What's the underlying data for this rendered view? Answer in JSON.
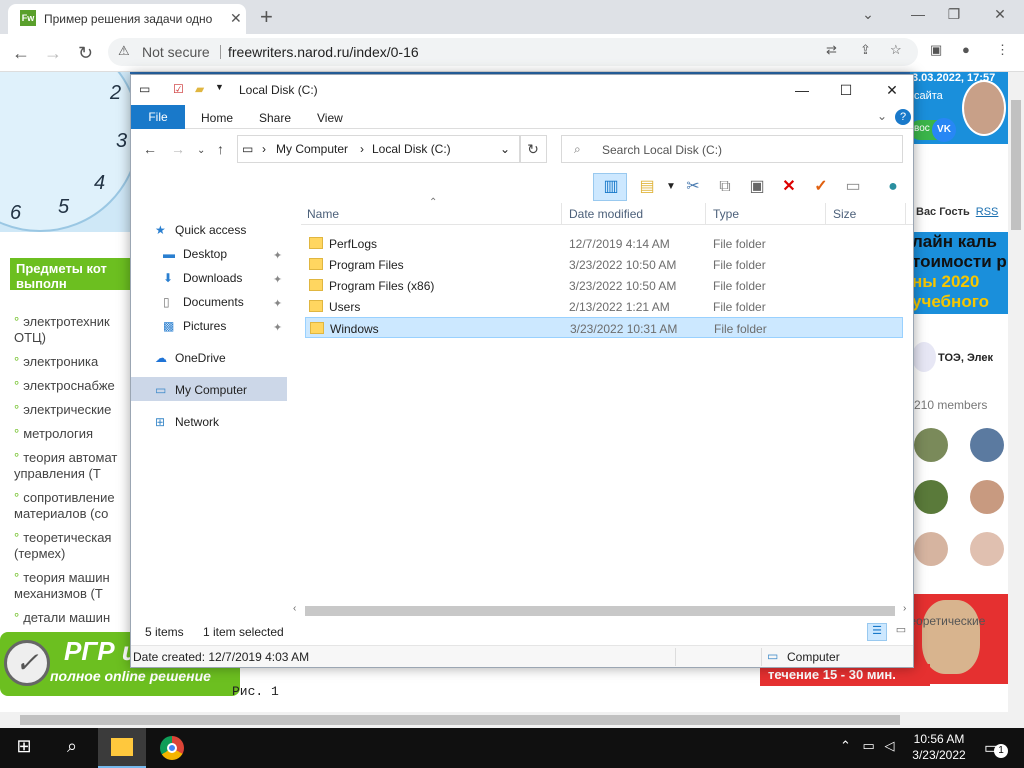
{
  "browser": {
    "tab_title": "Пример решения задачи одно",
    "favicon_text": "Fw",
    "security_label": "Not secure",
    "url": "freewriters.narod.ru/index/0-16"
  },
  "site": {
    "clock_numbers": [
      "2",
      "3",
      "4",
      "5",
      "6"
    ],
    "green_header": "Предметы кот выполн",
    "nav_items": [
      "электротехник ОТЦ)",
      "электроника",
      "электроснабже",
      "электрические",
      "метрология",
      "теория автомат управления (Т",
      "сопротивление материалов (со",
      "теоретическая (термех)",
      "теория машин механизмов (Т",
      "детали машин"
    ],
    "rgr_big": "РГР и",
    "rgr_small": "полное online решение",
    "figure_label": "Рис. 1",
    "vk_date": "3.03.2022, 17:57",
    "vk_name": "сайта",
    "vk_button": "вос",
    "vk_logo": "VK",
    "rss_prefix": "Вас Гость",
    "rss_link": "RSS",
    "ad_lines": [
      "лайн каль",
      "тоимости р",
      "ны 2020",
      "учебного"
    ],
    "group_name": "ТОЭ, Элек",
    "members": "210 members",
    "red_strip": "течение 15 - 30 мин.",
    "right_bottom": "теоретические"
  },
  "explorer": {
    "title": "Local Disk (C:)",
    "ribbon_tabs": [
      "File",
      "Home",
      "Share",
      "View"
    ],
    "path": [
      "My Computer",
      "Local Disk (C:)"
    ],
    "search_placeholder": "Search Local Disk (C:)",
    "nav": {
      "quick_access": "Quick access",
      "pinned": [
        "Desktop",
        "Downloads",
        "Documents",
        "Pictures"
      ],
      "onedrive": "OneDrive",
      "my_computer": "My Computer",
      "network": "Network"
    },
    "columns": [
      "Name",
      "Date modified",
      "Type",
      "Size"
    ],
    "rows": [
      {
        "name": "PerfLogs",
        "date": "12/7/2019 4:14 AM",
        "type": "File folder"
      },
      {
        "name": "Program Files",
        "date": "3/23/2022 10:50 AM",
        "type": "File folder"
      },
      {
        "name": "Program Files (x86)",
        "date": "3/23/2022 10:50 AM",
        "type": "File folder"
      },
      {
        "name": "Users",
        "date": "2/13/2022 1:21 AM",
        "type": "File folder"
      },
      {
        "name": "Windows",
        "date": "3/23/2022 10:31 AM",
        "type": "File folder"
      }
    ],
    "selected_row": "Windows",
    "status_items": "5 items",
    "status_selected": "1 item selected",
    "detail_created": "Date created: 12/7/2019 4:03 AM",
    "detail_location": "Computer"
  },
  "taskbar": {
    "time": "10:56 AM",
    "date": "3/23/2022",
    "notification_count": "1"
  },
  "colors": {
    "file_tab": "#1979ca",
    "selection": "#cce8ff",
    "folder": "#ffd660",
    "site_green": "#6cbf20",
    "taskbar": "#101010"
  }
}
